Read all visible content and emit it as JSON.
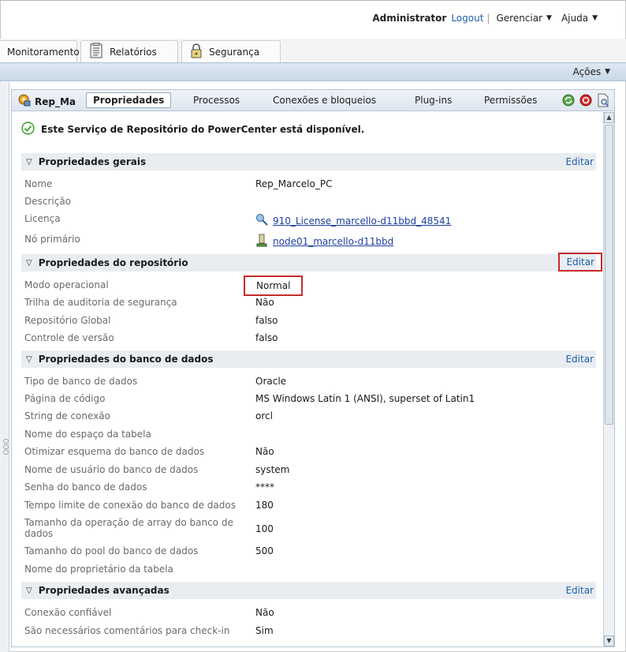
{
  "header": {
    "user": "Administrator",
    "logout": "Logout",
    "separator": "|",
    "manage": "Gerenciar",
    "help": "Ajuda"
  },
  "main_tabs": [
    {
      "label": "Monitoramento",
      "icon": null
    },
    {
      "label": "Relatórios",
      "icon": "report-icon"
    },
    {
      "label": "Segurança",
      "icon": "lock-icon"
    }
  ],
  "actions_label": "Ações",
  "panel": {
    "repo_name": "Rep_Ma",
    "tabs": [
      "Propriedades",
      "Processos",
      "Conexões e bloqueios",
      "Plug-ins",
      "Permissões"
    ],
    "active_tab": "Propriedades",
    "status_message": "Este Serviço de Repositório do PowerCenter está disponível.",
    "edit_label": "Editar"
  },
  "sections": {
    "general": {
      "title": "Propriedades gerais",
      "rows": [
        {
          "label": "Nome",
          "value": "Rep_Marcelo_PC"
        },
        {
          "label": "Descrição",
          "value": ""
        },
        {
          "label": "Licença",
          "value": "910_License_marcello-d11bbd_48541"
        },
        {
          "label": "Nó primário",
          "value": "node01_marcello-d11bbd"
        }
      ]
    },
    "repository": {
      "title": "Propriedades do repositório",
      "rows": [
        {
          "label": "Modo operacional",
          "value": "Normal"
        },
        {
          "label": "Trilha de auditoria de segurança",
          "value": "Não"
        },
        {
          "label": "Repositório Global",
          "value": "falso"
        },
        {
          "label": "Controle de versão",
          "value": "falso"
        }
      ]
    },
    "database": {
      "title": "Propriedades do banco de dados",
      "rows": [
        {
          "label": "Tipo de banco de dados",
          "value": "Oracle"
        },
        {
          "label": "Página de código",
          "value": "MS Windows Latin 1 (ANSI), superset of Latin1"
        },
        {
          "label": "String de conexão",
          "value": "orcl"
        },
        {
          "label": "Nome do espaço da tabela",
          "value": ""
        },
        {
          "label": "Otimizar esquema do banco de dados",
          "value": "Não"
        },
        {
          "label": "Nome de usuário do banco de dados",
          "value": "system"
        },
        {
          "label": "Senha do banco de dados",
          "value": "****"
        },
        {
          "label": "Tempo limite de conexão do banco de dados",
          "value": "180"
        },
        {
          "label": "Tamanho da operação de array do banco de dados",
          "value": "100"
        },
        {
          "label": "Tamanho do pool do banco de dados",
          "value": "500"
        },
        {
          "label": "Nome do proprietário da tabela",
          "value": ""
        }
      ]
    },
    "advanced": {
      "title": "Propriedades avançadas",
      "rows": [
        {
          "label": "Conexão confiável",
          "value": "Não"
        },
        {
          "label": "São necessários comentários para check-in",
          "value": "Sim"
        }
      ]
    }
  }
}
